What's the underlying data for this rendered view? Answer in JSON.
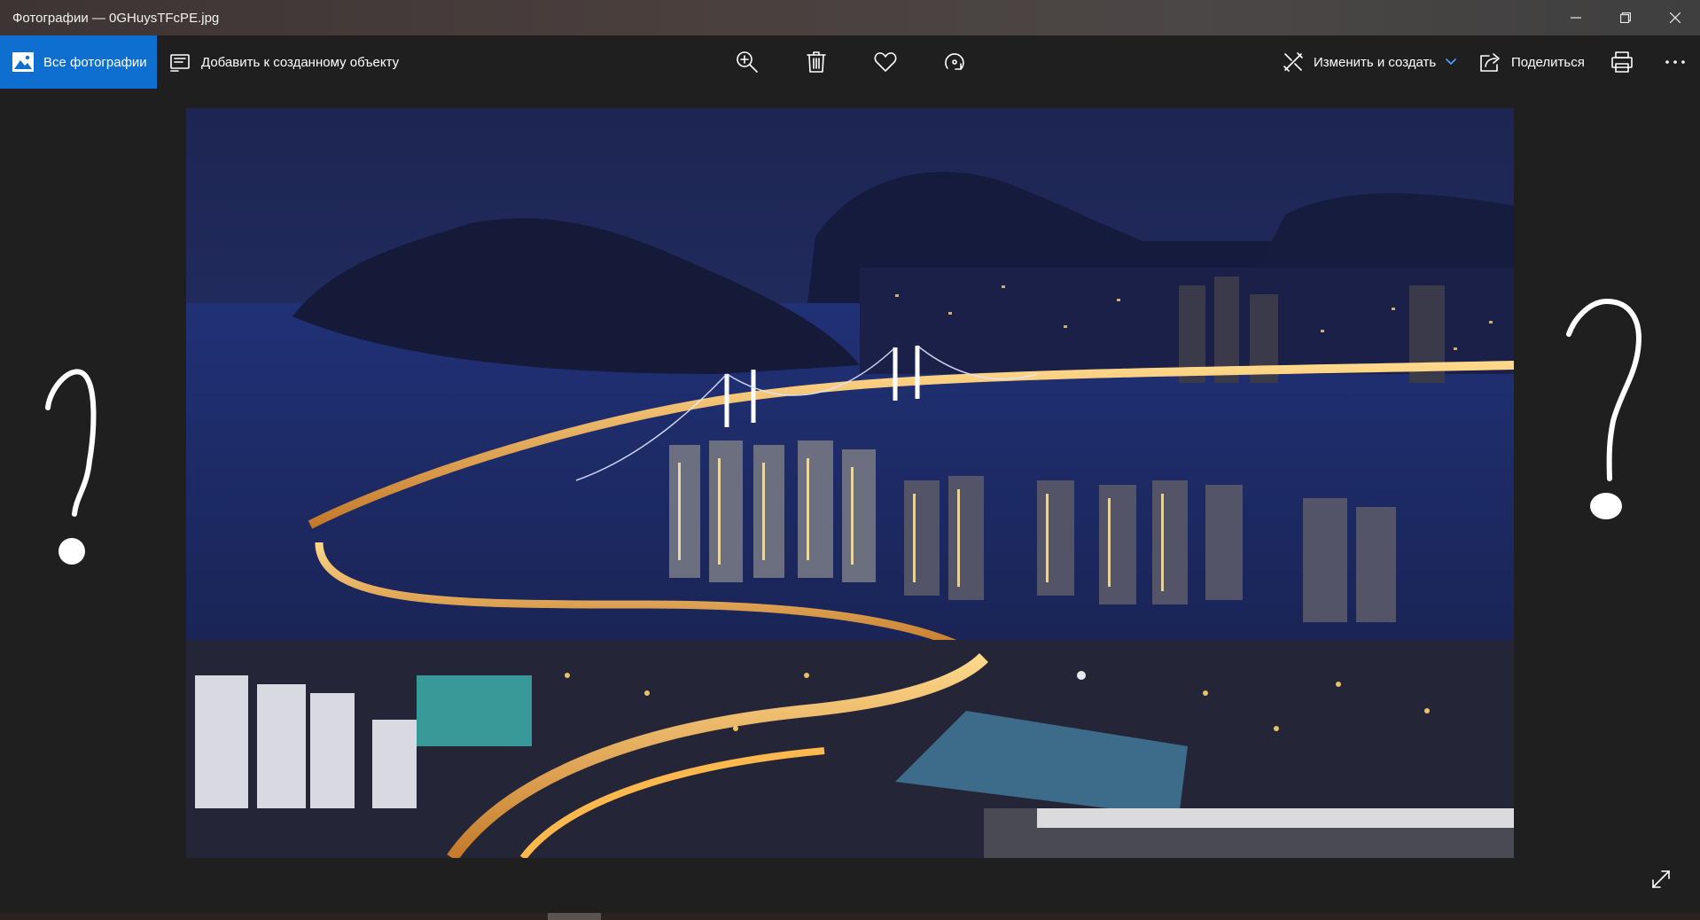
{
  "window": {
    "title": "Фотографии — 0GHuysTFcPE.jpg"
  },
  "toolbar": {
    "all_photos_label": "Все фотографии",
    "add_to_creation_label": "Добавить к созданному объекту",
    "edit_create_label": "Изменить и создать",
    "share_label": "Поделиться",
    "icons": [
      "zoom-in-icon",
      "trash-icon",
      "heart-icon",
      "rotate-icon",
      "print-icon",
      "more-icon"
    ]
  },
  "photo": {
    "subject": "night city skyline with suspension bridge",
    "colors": {
      "sky": "#1e2a5c",
      "water": "#1a2a66",
      "lights": "#ffc766"
    }
  },
  "annotations": {
    "marks": [
      "?",
      "?"
    ],
    "color": "#ffffff"
  },
  "colors": {
    "accent": "#0f6fd0",
    "toolbar_bg": "#1f1f1f"
  }
}
